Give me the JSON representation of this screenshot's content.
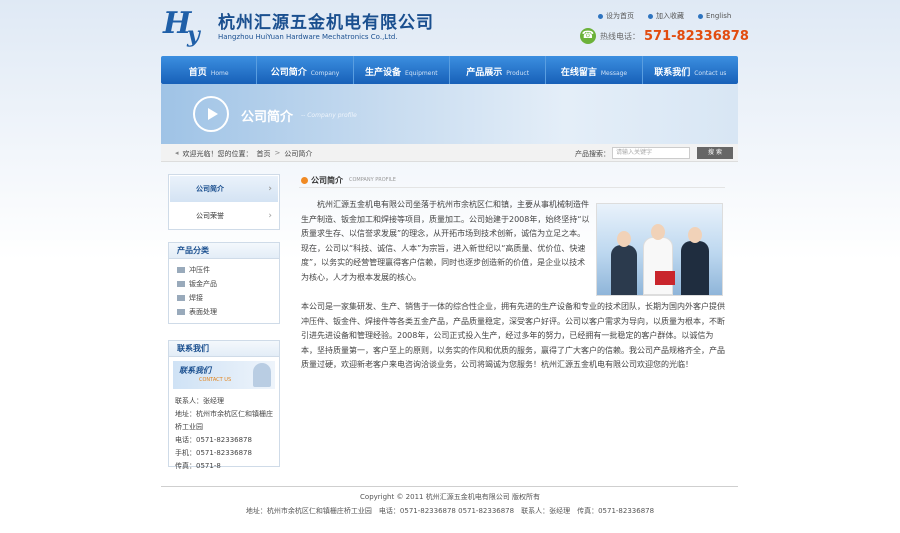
{
  "header": {
    "company_cn": "杭州汇源五金机电有限公司",
    "company_en": "Hangzhou HuiYuan Hardware Mechatronics Co.,Ltd.",
    "logo_h": "H",
    "logo_y": "y",
    "top_links": [
      "设为首页",
      "加入收藏",
      "English"
    ],
    "hotline_label": "热线电话：",
    "hotline_number": "571-82336878"
  },
  "nav": {
    "items": [
      {
        "cn": "首页",
        "en": "Home"
      },
      {
        "cn": "公司简介",
        "en": "Company"
      },
      {
        "cn": "生产设备",
        "en": "Equipment"
      },
      {
        "cn": "产品展示",
        "en": "Product"
      },
      {
        "cn": "在线留言",
        "en": "Message"
      },
      {
        "cn": "联系我们",
        "en": "Contact us"
      }
    ]
  },
  "banner": {
    "title": "公司简介",
    "subtitle": "-- Company profile"
  },
  "breadcrumb": {
    "prefix": "欢迎光临！您的位置：",
    "home": "首页",
    "current": "公司简介",
    "search_label": "产品搜索：",
    "search_placeholder": "请输入关键字",
    "search_button": "搜 索"
  },
  "sidebar": {
    "menu": [
      {
        "label": "公司简介",
        "active": true
      },
      {
        "label": "公司荣誉",
        "active": false
      }
    ],
    "categories_title": "产品分类",
    "categories": [
      "冲压件",
      "钣金产品",
      "焊接",
      "表面处理"
    ],
    "contact_title": "联系我们",
    "contact_banner_cn": "联系我们",
    "contact_banner_en": "CONTACT US",
    "contact_lines": [
      "联系人：张经理",
      "地址：杭州市余杭区仁和镇栅庄",
      "桥工业园",
      "电话：0571-82336878",
      "手机：0571-82336878",
      "传真：0571-8"
    ]
  },
  "content": {
    "title": "公司简介",
    "title_en": "COMPANY PROFILE",
    "paragraph_top": "杭州汇源五金机电有限公司坐落于杭州市余杭区仁和镇，主要从事机械制造件生产制造、钣金加工和焊接等项目，质量加工。公司始建于2008年，始终坚持“以质量求生存、以信誉求发展”的理念，从开拓市场到技术创新，诚信为立足之本。现在，公司以“科技、诚信、人本”为宗旨，进入新世纪以“高质量、优价位、快速度”，以务实的经营管理赢得客户信赖，同时也逐步创造新的价值，是企业以技术为核心，人才为根本发展的核心。",
    "paragraph_bottom": "本公司是一家集研发、生产、销售于一体的综合性企业，拥有先进的生产设备和专业的技术团队，长期为国内外客户提供冲压件、钣金件、焊接件等各类五金产品，产品质量稳定，深受客户好评。公司以客户需求为导向，以质量为根本，不断引进先进设备和管理经验。2008年，公司正式投入生产，经过多年的努力，已经拥有一批稳定的客户群体。以诚信为本，坚持质量第一，客户至上的原则，以务实的作风和优质的服务，赢得了广大客户的信赖。我公司产品规格齐全，产品质量过硬，欢迎新老客户来电咨询洽谈业务，公司将竭诚为您服务！杭州汇源五金机电有限公司欢迎您的光临！"
  },
  "footer": {
    "copyright": "Copyright © 2011 杭州汇源五金机电有限公司 版权所有",
    "address_line": "地址：杭州市余杭区仁和镇栅庄桥工业园　电话：0571-82336878 0571-82336878　联系人：张经理　传真：0571-82336878"
  },
  "colors": {
    "brand_blue": "#1a4f8f",
    "nav_blue": "#1760b8",
    "hotline_orange": "#e24c0f",
    "accent_orange": "#f08a24"
  }
}
